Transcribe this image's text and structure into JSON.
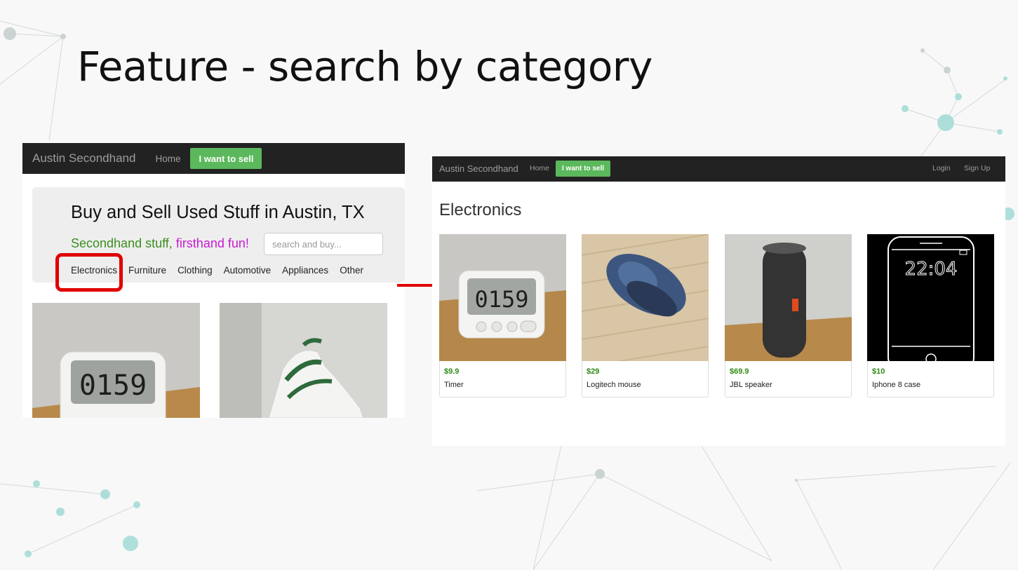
{
  "slide": {
    "title": "Feature - search by category"
  },
  "left_screenshot": {
    "brand": "Austin Secondhand",
    "nav_home": "Home",
    "sell_button": "I want to sell",
    "headline": "Buy and Sell Used Stuff in Austin, TX",
    "tagline_green": "Secondhand stuff,",
    "tagline_pink": "firsthand fun!",
    "search_placeholder": "search and buy...",
    "categories": [
      "Electronics",
      "Furniture",
      "Clothing",
      "Automotive",
      "Appliances",
      "Other"
    ],
    "highlighted_category": "Electronics",
    "highlight_color": "#e10000"
  },
  "right_screenshot": {
    "brand": "Austin Secondhand",
    "nav_home": "Home",
    "sell_button": "I want to sell",
    "login": "Login",
    "signup": "Sign Up",
    "category_heading": "Electronics",
    "products": [
      {
        "price": "$9.9",
        "name": "Timer"
      },
      {
        "price": "$29",
        "name": "Logitech mouse"
      },
      {
        "price": "$69.9",
        "name": "JBL speaker"
      },
      {
        "price": "$10",
        "name": "Iphone 8 case"
      }
    ],
    "phone_sketch_time": "22:04"
  },
  "colors": {
    "navbar": "#222222",
    "sell_green": "#5cb85c",
    "price_green": "#2f8a13",
    "arrow_red": "#e10000"
  }
}
